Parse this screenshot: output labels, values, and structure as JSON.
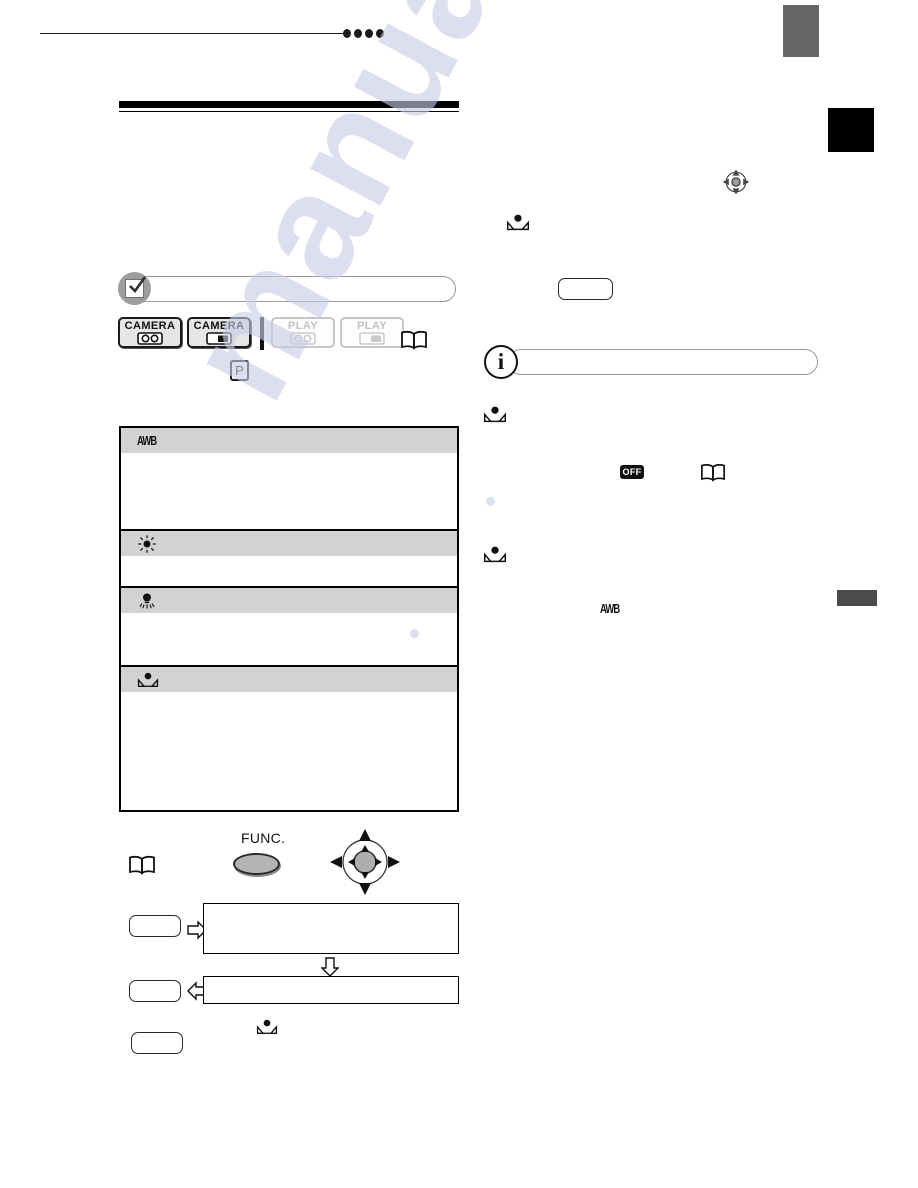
{
  "page": {
    "header_dots_count": 4,
    "watermark": "manualslive.com"
  },
  "mode_bar": {
    "items": [
      {
        "label": "CAMERA",
        "media": "tape",
        "state": "active",
        "icon": "camera-tape-icon"
      },
      {
        "label": "CAMERA",
        "media": "card",
        "state": "active",
        "icon": "camera-card-icon"
      },
      {
        "label": "PLAY",
        "media": "tape",
        "state": "inactive",
        "icon": "play-tape-icon"
      },
      {
        "label": "PLAY",
        "media": "card",
        "state": "inactive",
        "icon": "play-card-icon"
      }
    ],
    "program_badge": "P",
    "reference_icon": "book-icon"
  },
  "white_balance_table": {
    "rows": [
      {
        "icon": "awb-icon",
        "icon_label": "AWB",
        "body_text": ""
      },
      {
        "icon": "daylight-sun-icon",
        "icon_label": "",
        "body_text": ""
      },
      {
        "icon": "tungsten-bulb-icon",
        "icon_label": "",
        "body_text": ""
      },
      {
        "icon": "custom-white-balance-icon",
        "icon_label": "",
        "body_text": ""
      }
    ]
  },
  "controls": {
    "func_button_label": "FUNC.",
    "joystick_icon": "joystick-icon",
    "reference_icon": "book-icon"
  },
  "flow": {
    "steps": [
      {
        "button_label": "",
        "arrow": "right",
        "box_text": ""
      },
      {
        "arrow": "down"
      },
      {
        "button_label": "",
        "arrow": "left",
        "box_text": ""
      },
      {
        "button_label": "",
        "icon": "custom-white-balance-icon"
      }
    ]
  },
  "right_column": {
    "joystick_icon": "joystick-icon",
    "custom_wb_icon": "custom-white-balance-icon",
    "action_button_label": "",
    "info_note_text": "",
    "off_badge_label": "OFF",
    "book_icon": "book-icon",
    "awb_label": "AWB"
  },
  "colors": {
    "tab_gray": "#666666",
    "tab_black": "#000000",
    "tab_gray_mid": "#4b4b4b",
    "table_header_gray": "#d2d2d2",
    "rule_black": "#1b1b1b",
    "badge_gray": "#e6e6e6",
    "watermark_blue": "#c9cbe8"
  }
}
